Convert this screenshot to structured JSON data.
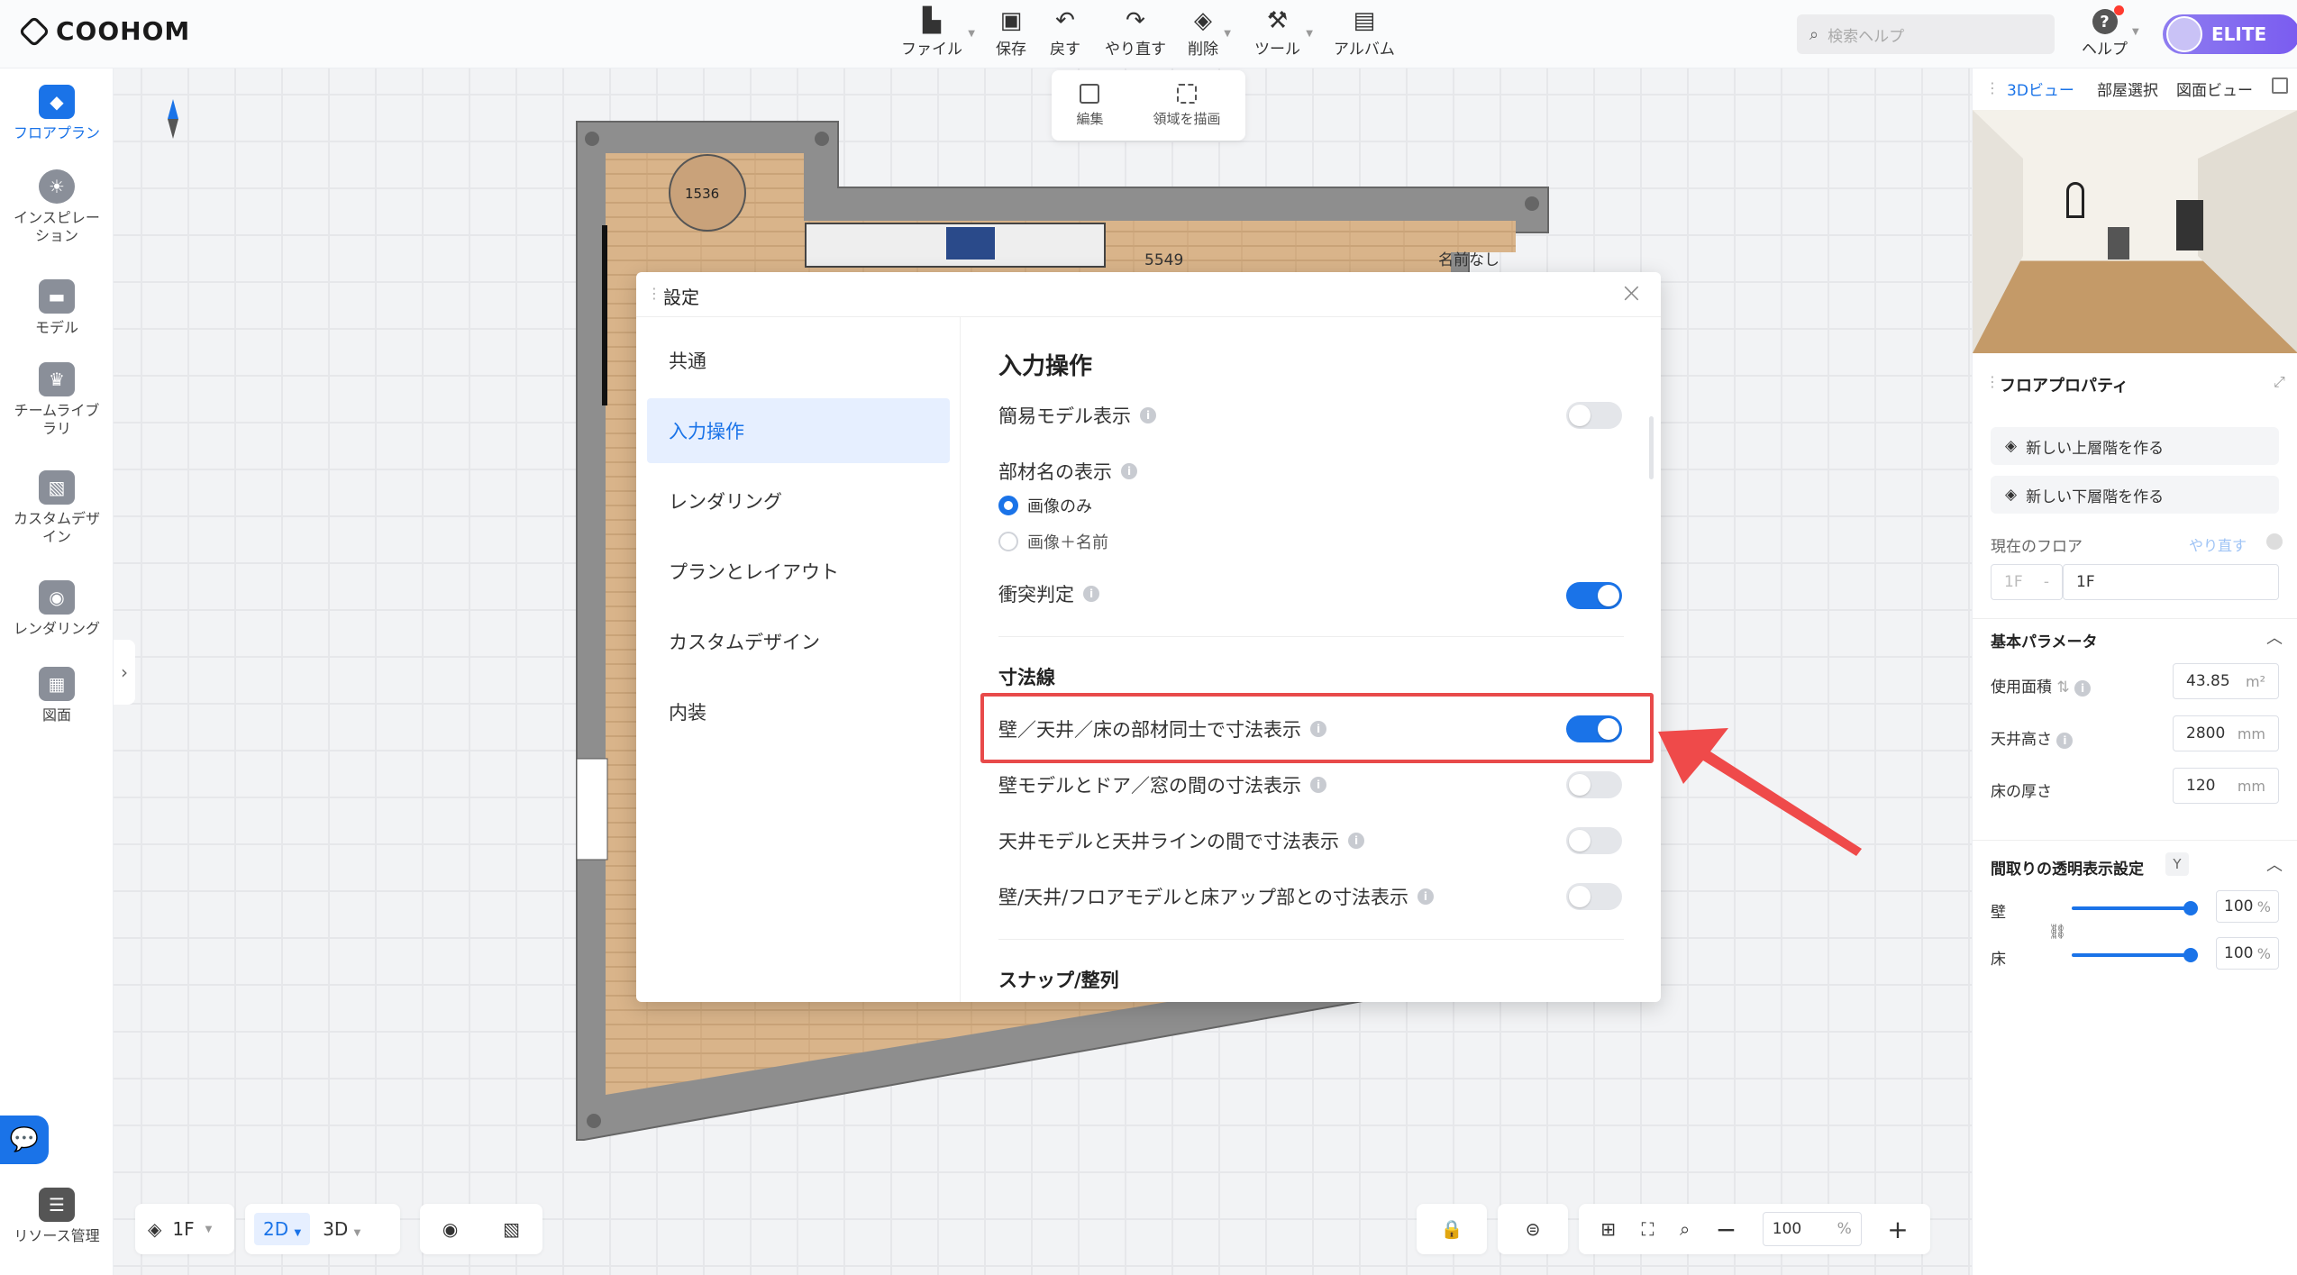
{
  "app": {
    "logo": "COOHOM"
  },
  "toolbar": {
    "items": [
      {
        "label": "ファイル",
        "icon": "file-icon"
      },
      {
        "label": "保存",
        "icon": "save-icon"
      },
      {
        "label": "戻す",
        "icon": "undo-icon"
      },
      {
        "label": "やり直す",
        "icon": "redo-icon"
      },
      {
        "label": "削除",
        "icon": "eraser-icon"
      },
      {
        "label": "ツール",
        "icon": "wrench-icon"
      },
      {
        "label": "アルバム",
        "icon": "album-icon"
      }
    ],
    "search_placeholder": "検索ヘルプ",
    "help_label": "ヘルプ",
    "elite_label": "ELITE"
  },
  "subtoolbar": {
    "edit_label": "編集",
    "draw_area_label": "領域を描画"
  },
  "sidebar": {
    "items": [
      {
        "label": "フロアプラン",
        "icon": "floorplan-icon",
        "active": true
      },
      {
        "label": "インスピレーション",
        "icon": "bulb-icon"
      },
      {
        "label": "モデル",
        "icon": "sofa-icon"
      },
      {
        "label": "チームライブラリ",
        "icon": "crown-icon"
      },
      {
        "label": "カスタムデザイン",
        "icon": "box-icon"
      },
      {
        "label": "レンダリング",
        "icon": "camera-icon"
      },
      {
        "label": "図面",
        "icon": "drawing-icon"
      }
    ],
    "resource_label": "リソース管理"
  },
  "canvas": {
    "dim_1": "1536",
    "dim_2": "5549",
    "room_name": "名前なし"
  },
  "dialog": {
    "title": "設定",
    "nav": [
      "共通",
      "入力操作",
      "レンダリング",
      "プランとレイアウト",
      "カスタムデザイン",
      "内装"
    ],
    "active_nav": "入力操作",
    "section_title": "入力操作",
    "simple_model": {
      "label": "簡易モデル表示",
      "on": false
    },
    "part_name": {
      "label": "部材名の表示",
      "options": [
        "画像のみ",
        "画像＋名前"
      ],
      "selected": "画像のみ"
    },
    "collision": {
      "label": "衝突判定",
      "on": true
    },
    "dimension_title": "寸法線",
    "dim_rows": [
      {
        "label": "壁／天井／床の部材同士で寸法表示",
        "on": true
      },
      {
        "label": "壁モデルとドア／窓の間の寸法表示",
        "on": false
      },
      {
        "label": "天井モデルと天井ラインの間で寸法表示",
        "on": false
      },
      {
        "label": "壁/天井/フロアモデルと床アップ部との寸法表示",
        "on": false
      }
    ],
    "snap_title": "スナップ/整列"
  },
  "right_panel": {
    "tabs": [
      "3Dビュー",
      "部屋選択",
      "図面ビュー"
    ],
    "floor_props_title": "フロアプロパティ",
    "btn_upper": "新しい上層階を作る",
    "btn_lower": "新しい下層階を作る",
    "current_floor_label": "現在のフロア",
    "redo_link": "やり直す",
    "floor_prefix": "1F",
    "floor_value": "1F",
    "basic_params_title": "基本パラメータ",
    "area_label": "使用面積",
    "area_value": "43.85",
    "area_unit": "m²",
    "ceiling_label": "天井高さ",
    "ceiling_value": "2800",
    "ceiling_unit": "mm",
    "floor_thick_label": "床の厚さ",
    "floor_thick_value": "120",
    "floor_thick_unit": "mm",
    "transparency_title": "間取りの透明表示設定",
    "transparency_key": "Y",
    "wall_label": "壁",
    "wall_value": "100",
    "floor_label": "床",
    "floor_value2": "100",
    "percent": "%"
  },
  "bottombar": {
    "floor": "1F",
    "view_2d": "2D",
    "view_3d": "3D",
    "zoom": "100",
    "zoom_unit": "%"
  },
  "colors": {
    "accent": "#1a73e8",
    "highlight": "#e84a4a"
  }
}
